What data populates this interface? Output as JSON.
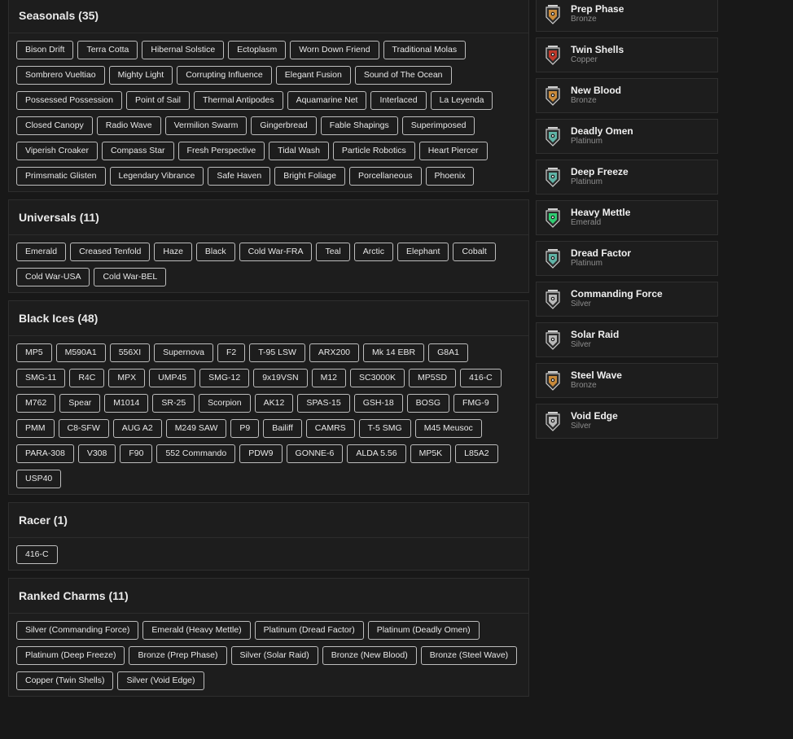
{
  "sections": [
    {
      "title": "Seasonals (35)",
      "items": [
        "Bison Drift",
        "Terra Cotta",
        "Hibernal Solstice",
        "Ectoplasm",
        "Worn Down Friend",
        "Traditional Molas",
        "Sombrero Vueltiao",
        "Mighty Light",
        "Corrupting Influence",
        "Elegant Fusion",
        "Sound of The Ocean",
        "Possessed Possession",
        "Point of Sail",
        "Thermal Antipodes",
        "Aquamarine Net",
        "Interlaced",
        "La Leyenda",
        "Closed Canopy",
        "Radio Wave",
        "Vermilion Swarm",
        "Gingerbread",
        "Fable Shapings",
        "Superimposed",
        "Viperish Croaker",
        "Compass Star",
        "Fresh Perspective",
        "Tidal Wash",
        "Particle Robotics",
        "Heart Piercer",
        "Primsmatic Glisten",
        "Legendary Vibrance",
        "Safe Haven",
        "Bright Foliage",
        "Porcellaneous",
        "Phoenix"
      ]
    },
    {
      "title": "Universals (11)",
      "items": [
        "Emerald",
        "Creased Tenfold",
        "Haze",
        "Black",
        "Cold War-FRA",
        "Teal",
        "Arctic",
        "Elephant",
        "Cobalt",
        "Cold War-USA",
        "Cold War-BEL"
      ]
    },
    {
      "title": "Black Ices (48)",
      "items": [
        "MP5",
        "M590A1",
        "556XI",
        "Supernova",
        "F2",
        "T-95 LSW",
        "ARX200",
        "Mk 14 EBR",
        "G8A1",
        "SMG-11",
        "R4C",
        "MPX",
        "UMP45",
        "SMG-12",
        "9x19VSN",
        "M12",
        "SC3000K",
        "MP5SD",
        "416-C",
        "M762",
        "Spear",
        "M1014",
        "SR-25",
        "Scorpion",
        "AK12",
        "SPAS-15",
        "GSH-18",
        "BOSG",
        "FMG-9",
        "PMM",
        "C8-SFW",
        "AUG A2",
        "M249 SAW",
        "P9",
        "Bailiff",
        "CAMRS",
        "T-5 SMG",
        "M45 Meusoc",
        "PARA-308",
        "V308",
        "F90",
        "552 Commando",
        "PDW9",
        "GONNE-6",
        "ALDA 5.56",
        "MP5K",
        "L85A2",
        "USP40"
      ]
    },
    {
      "title": "Racer (1)",
      "items": [
        "416-C"
      ]
    },
    {
      "title": "Ranked Charms (11)",
      "items": [
        "Silver (Commanding Force)",
        "Emerald (Heavy Mettle)",
        "Platinum (Dread Factor)",
        "Platinum (Deadly Omen)",
        "Platinum (Deep Freeze)",
        "Bronze (Prep Phase)",
        "Silver (Solar Raid)",
        "Bronze (New Blood)",
        "Bronze (Steel Wave)",
        "Copper (Twin Shells)",
        "Silver (Void Edge)"
      ]
    }
  ],
  "charms": [
    {
      "name": "Prep Phase",
      "tier": "Bronze",
      "icon": "bronze-rank-icon",
      "color": "#c98a3a"
    },
    {
      "name": "Twin Shells",
      "tier": "Copper",
      "icon": "copper-rank-icon",
      "color": "#c0392b"
    },
    {
      "name": "New Blood",
      "tier": "Bronze",
      "icon": "bronze-rank-icon",
      "color": "#c98a3a"
    },
    {
      "name": "Deadly Omen",
      "tier": "Platinum",
      "icon": "platinum-rank-icon",
      "color": "#5fb3a6"
    },
    {
      "name": "Deep Freeze",
      "tier": "Platinum",
      "icon": "platinum-rank-icon",
      "color": "#5fb3a6"
    },
    {
      "name": "Heavy Mettle",
      "tier": "Emerald",
      "icon": "emerald-rank-icon",
      "color": "#2ecc71"
    },
    {
      "name": "Dread Factor",
      "tier": "Platinum",
      "icon": "platinum-rank-icon",
      "color": "#5fb3a6"
    },
    {
      "name": "Commanding Force",
      "tier": "Silver",
      "icon": "silver-rank-icon",
      "color": "#b9b9b9"
    },
    {
      "name": "Solar Raid",
      "tier": "Silver",
      "icon": "silver-rank-icon",
      "color": "#b9b9b9"
    },
    {
      "name": "Steel Wave",
      "tier": "Bronze",
      "icon": "bronze-rank-icon",
      "color": "#c98a3a"
    },
    {
      "name": "Void Edge",
      "tier": "Silver",
      "icon": "silver-rank-icon",
      "color": "#b9b9b9"
    }
  ]
}
